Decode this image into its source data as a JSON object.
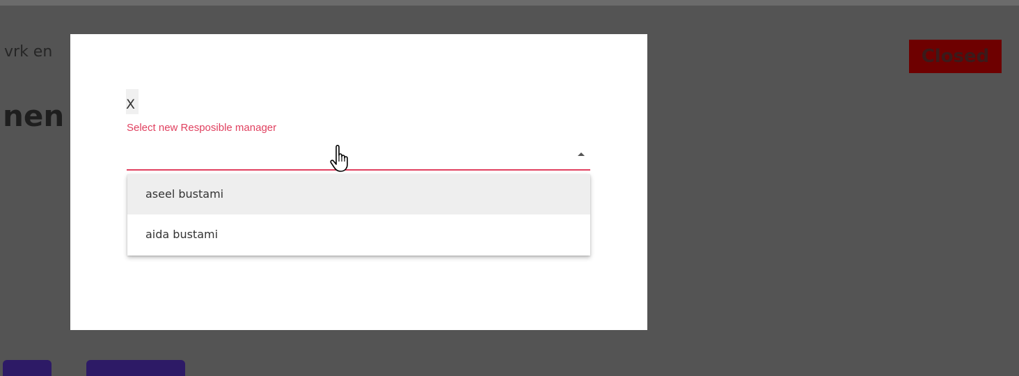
{
  "background": {
    "subtitle": "vrk en",
    "heading": "nen",
    "status_badge": "Closed"
  },
  "modal": {
    "close_label": "X",
    "field_label": "Select new Resposible manager",
    "options": [
      {
        "label": "aseel bustami",
        "highlighted": true
      },
      {
        "label": "aida bustami",
        "highlighted": false
      }
    ]
  },
  "colors": {
    "overlay": "#545454",
    "accent": "#e0405f",
    "status_badge": "#6e0000",
    "background_button": "#2d1a66"
  },
  "icons": {
    "dropdown_arrow": "arrow-up-icon",
    "cursor": "hand-pointer-icon"
  }
}
